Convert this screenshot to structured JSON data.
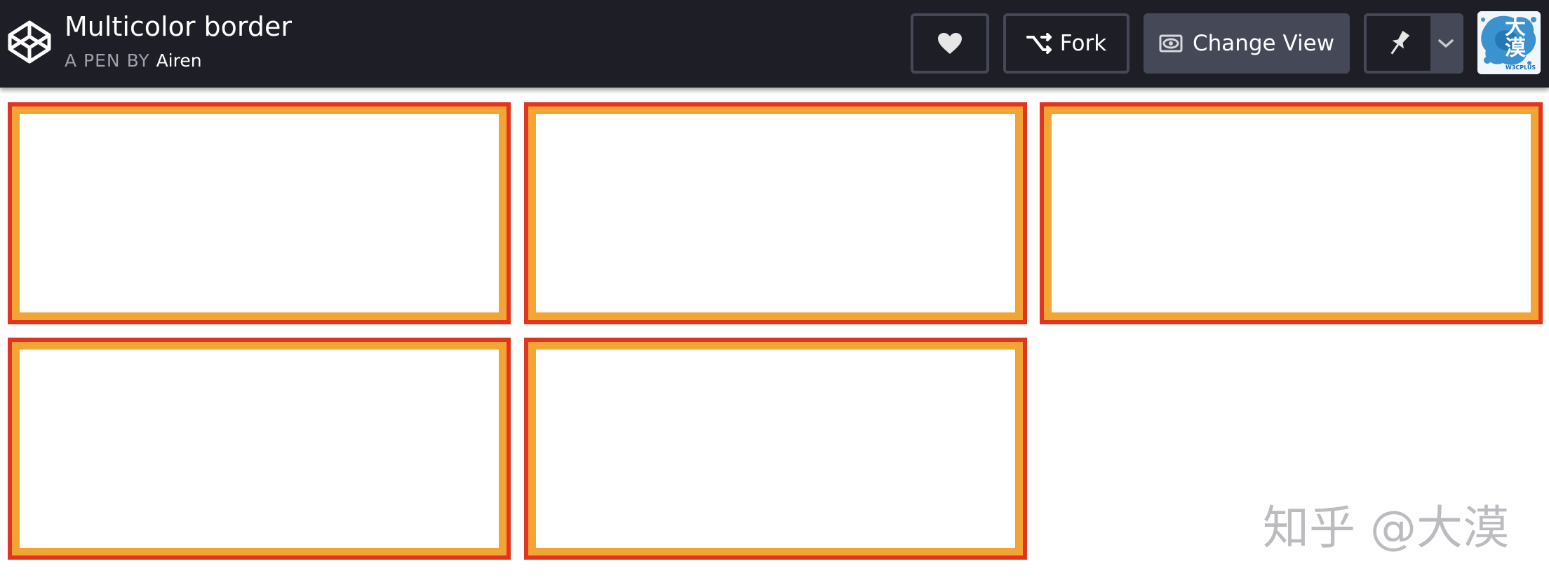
{
  "header": {
    "title": "Multicolor border",
    "byline_prefix": "A PEN BY",
    "author": "Airen",
    "logo_icon": "codepen-logo-icon"
  },
  "toolbar": {
    "heart_icon": "heart-icon",
    "fork_label": "Fork",
    "fork_icon": "fork-icon",
    "change_view_label": "Change View",
    "change_view_icon": "eye-icon",
    "pin_icon": "pin-icon",
    "chevron_icon": "chevron-down-icon"
  },
  "avatar": {
    "text": "大漠",
    "small_text": "W3CPLUS"
  },
  "boxes": {
    "count": 5,
    "outer_color": "#e3341f",
    "inner_color": "#f2a535"
  },
  "watermark": "知乎 @大漠",
  "colors": {
    "topbar": "#1e1f26",
    "button_border": "#444857",
    "text_muted": "#9ea1ad"
  }
}
